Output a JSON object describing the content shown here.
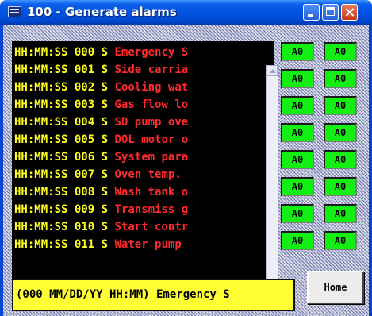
{
  "window": {
    "title": "100 - Generate alarms",
    "minimize_label": "",
    "maximize_label": "",
    "close_label": ""
  },
  "alarms": [
    {
      "time": "HH:MM:SS",
      "id": "000",
      "state": "S",
      "message": "Emergency S"
    },
    {
      "time": "HH:MM:SS",
      "id": "001",
      "state": "S",
      "message": "Side carria"
    },
    {
      "time": "HH:MM:SS",
      "id": "002",
      "state": "S",
      "message": "Cooling wat"
    },
    {
      "time": "HH:MM:SS",
      "id": "003",
      "state": "S",
      "message": "Gas flow lo"
    },
    {
      "time": "HH:MM:SS",
      "id": "004",
      "state": "S",
      "message": "SD pump ove"
    },
    {
      "time": "HH:MM:SS",
      "id": "005",
      "state": "S",
      "message": "DOL motor o"
    },
    {
      "time": "HH:MM:SS",
      "id": "006",
      "state": "S",
      "message": "System para"
    },
    {
      "time": "HH:MM:SS",
      "id": "007",
      "state": "S",
      "message": "Oven temp."
    },
    {
      "time": "HH:MM:SS",
      "id": "008",
      "state": "S",
      "message": "Wash tank o"
    },
    {
      "time": "HH:MM:SS",
      "id": "009",
      "state": "S",
      "message": "Transmiss g"
    },
    {
      "time": "HH:MM:SS",
      "id": "010",
      "state": "S",
      "message": "Start contr"
    },
    {
      "time": "HH:MM:SS",
      "id": "011",
      "state": "S",
      "message": "Water pump"
    }
  ],
  "ack_buttons": [
    "A0",
    "A0",
    "A0",
    "A0",
    "A0",
    "A0",
    "A0",
    "A0",
    "A0",
    "A0",
    "A0",
    "A0",
    "A0",
    "A0",
    "A0",
    "A0"
  ],
  "status_bar": {
    "text": "(000 MM/DD/YY HH:MM) Emergency S"
  },
  "home_button": {
    "label": "Home"
  },
  "colors": {
    "list_background": "#000000",
    "time_text": "#ffff1e",
    "alarm_text": "#ff2a2a",
    "ack_button": "#13ef13",
    "status_background": "#ffff33",
    "title_bar": "#0054e3"
  },
  "icons": [
    "app-icon",
    "minimize-icon",
    "maximize-icon",
    "close-icon",
    "scroll-up-arrow-icon",
    "scroll-down-arrow-icon"
  ]
}
